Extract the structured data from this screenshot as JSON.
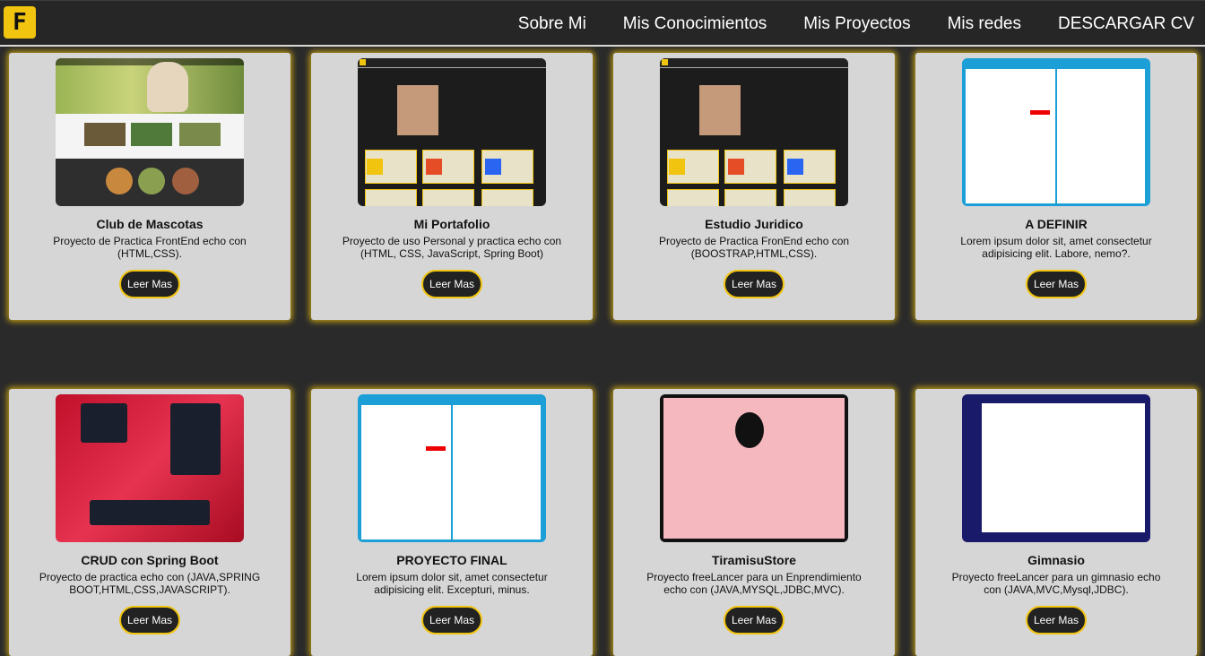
{
  "header": {
    "logo_letter": "F",
    "nav": [
      "Sobre Mi",
      "Mis Conocimientos",
      "Mis Proyectos",
      "Mis redes",
      "DESCARGAR CV"
    ]
  },
  "projects": [
    {
      "title": "Club de Mascotas",
      "desc": "Proyecto de Practica FrontEnd echo con (HTML,CSS).",
      "button": "Leer Mas",
      "thumb": "dog-site-screenshot"
    },
    {
      "title": "Mi Portafolio",
      "desc": "Proyecto de uso Personal y practica echo con (HTML, CSS, JavaScript, Spring Boot)",
      "button": "Leer Mas",
      "thumb": "portfolio-screenshot"
    },
    {
      "title": "Estudio Juridico",
      "desc": "Proyecto de Practica FronEnd echo con (BOOSTRAP,HTML,CSS).",
      "button": "Leer Mas",
      "thumb": "portfolio-screenshot"
    },
    {
      "title": "A DEFINIR",
      "desc": "Lorem ipsum dolor sit, amet consectetur adipisicing elit. Labore, nemo?.",
      "button": "Leer Mas",
      "thumb": "java-form-screenshot"
    },
    {
      "title": "CRUD con Spring Boot",
      "desc": "Proyecto de practica echo con (JAVA,SPRING BOOT,HTML,CSS,JAVASCRIPT).",
      "button": "Leer Mas",
      "thumb": "crud-screenshot"
    },
    {
      "title": "PROYECTO FINAL",
      "desc": "Lorem ipsum dolor sit, amet consectetur adipisicing elit. Excepturi, minus.",
      "button": "Leer Mas",
      "thumb": "java-form-screenshot"
    },
    {
      "title": "TiramisuStore",
      "desc": "Proyecto freeLancer para un Enprendimiento echo con (JAVA,MYSQL,JDBC,MVC).",
      "button": "Leer Mas",
      "thumb": "tiramisu-screenshot"
    },
    {
      "title": "Gimnasio",
      "desc": "Proyecto freeLancer para un gimnasio echo con (JAVA,MVC,Mysql,JDBC).",
      "button": "Leer Mas",
      "thumb": "gym-screenshot"
    }
  ],
  "colors": {
    "accent": "#f1c40f",
    "background": "#2a2a2a",
    "card": "#d6d6d6"
  }
}
